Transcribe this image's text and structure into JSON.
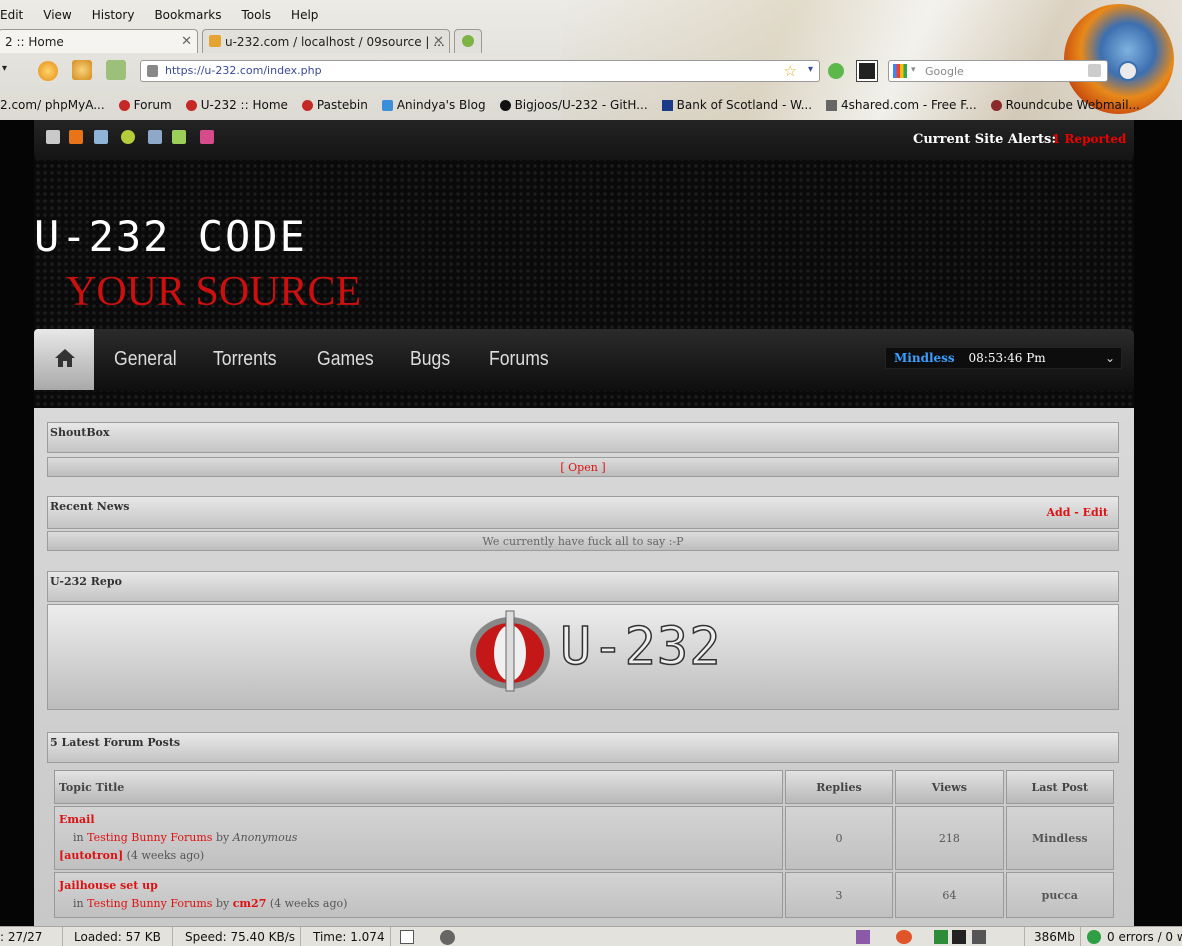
{
  "browser": {
    "menu": [
      "Edit",
      "View",
      "History",
      "Bookmarks",
      "Tools",
      "Help"
    ],
    "tabs": [
      {
        "label": "2 :: Home"
      },
      {
        "label": "u-232.com / localhost / 09source | ..."
      }
    ],
    "url": "https://u-232.com/index.php",
    "search_placeholder": "Google",
    "bookmarks": [
      "2.com/ phpMyA...",
      "Forum",
      "U-232 :: Home",
      "Pastebin",
      "Anindya's Blog",
      "Bigjoos/U-232 - GitH...",
      "Bank of Scotland - W...",
      "4shared.com - Free F...",
      "Roundcube Webmail..."
    ]
  },
  "site": {
    "alerts_label": "Current Site Alerts:",
    "alerts_value": "1 Reported",
    "logo_line1": "U-232 CODE",
    "logo_line2": "YOUR SOURCE",
    "nav": [
      "General",
      "Torrents",
      "Games",
      "Bugs",
      "Forums"
    ],
    "user": {
      "name": "Mindless",
      "time": "08:53:46 Pm"
    },
    "shoutbox": {
      "title": "ShoutBox",
      "open_link": "[ Open ]"
    },
    "news": {
      "title": "Recent News",
      "add": "Add",
      "sep": "-",
      "edit": "Edit",
      "message": "We currently have fuck all to say :-P"
    },
    "repo": {
      "title": "U-232 Repo",
      "logo_text": "U-232"
    },
    "forum": {
      "title": "5 Latest Forum Posts",
      "columns": [
        "Topic Title",
        "Replies",
        "Views",
        "Last Post"
      ],
      "rows": [
        {
          "topic": "Email",
          "in": "in",
          "forum": "Testing Bunny Forums",
          "by": "by",
          "poster": "Anonymous",
          "author": "[autotron]",
          "age": "(4 weeks ago)",
          "replies": "0",
          "views": "218",
          "last": "Mindless"
        },
        {
          "topic": "Jailhouse set up",
          "in": "in",
          "forum": "Testing Bunny Forums",
          "by": "by",
          "poster": "cm27",
          "age": "(4 weeks ago)",
          "replies": "3",
          "views": "64",
          "last": "pucca"
        }
      ]
    }
  },
  "statusbar": {
    "count": ": 27/27",
    "loaded": "Loaded: 57 KB",
    "speed": "Speed: 75.40 KB/s",
    "time": "Time: 1.074",
    "memory": "386Mb",
    "errors": "0 errors / 0 w"
  },
  "colors": {
    "accent_red": "#d11",
    "user_blue": "#3aa0ff",
    "logo_red": "#cc0f0f"
  }
}
